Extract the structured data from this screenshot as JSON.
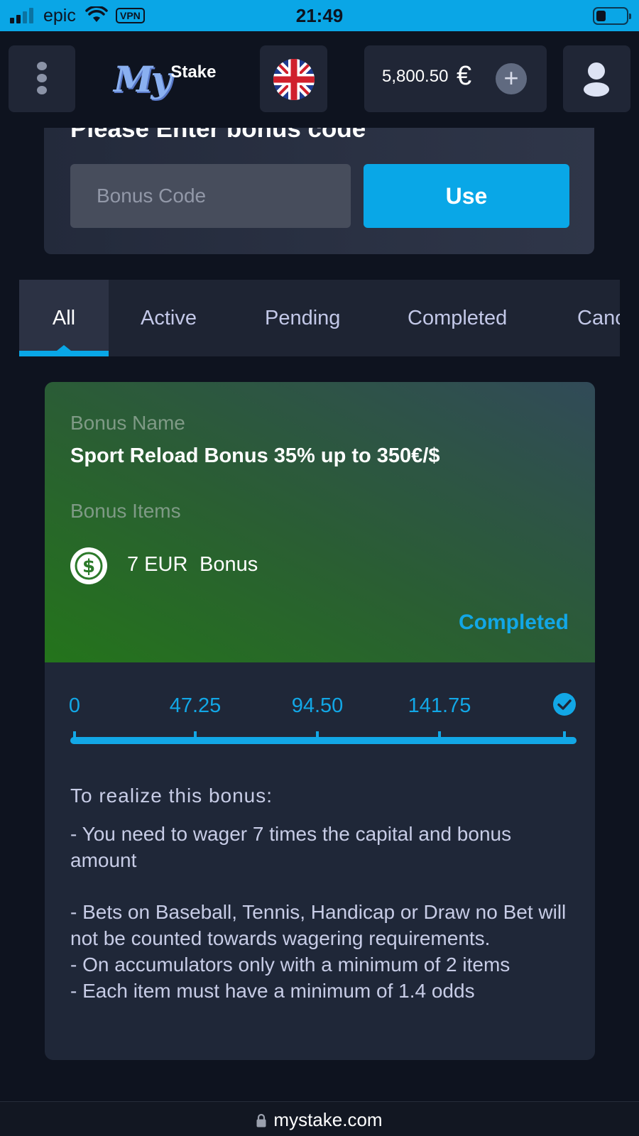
{
  "status_bar": {
    "carrier": "epic",
    "vpn": "VPN",
    "time": "21:49"
  },
  "header": {
    "logo_my": "My",
    "logo_stake": "Stake",
    "balance": "5,800.50",
    "currency_symbol": "€",
    "add_funds": "+"
  },
  "bonus_code": {
    "title": "Please Enter bonus code",
    "placeholder": "Bonus Code",
    "use_label": "Use"
  },
  "tabs": [
    "All",
    "Active",
    "Pending",
    "Completed",
    "Cancelled"
  ],
  "active_tab": "All",
  "bonus_card": {
    "name_label": "Bonus Name",
    "name": "Sport Reload Bonus 35% up to 350€/$",
    "items_label": "Bonus Items",
    "item_amount": "7 EUR",
    "item_type": "Bonus",
    "status": "Completed",
    "progress": {
      "ticks": [
        "0",
        "47.25",
        "94.50",
        "141.75"
      ],
      "fraction": 1.0
    },
    "description_heading": "To realize this bonus:",
    "description_lines": [
      "- You need to wager 7 times the capital and bonus amount",
      "- Bets on Baseball, Tennis, Handicap or Draw no Bet will not be counted towards wagering requirements.",
      "- On accumulators only with a minimum of 2 items",
      "- Each item must have a minimum of 1.4 odds"
    ]
  },
  "url_bar": {
    "url": "mystake.com"
  },
  "colors": {
    "accent": "#09a7e7",
    "status_bar": "#0aa6e6",
    "background": "#0e131f",
    "card": "#1f2738",
    "card_top_green": "#24741b"
  },
  "icons": [
    "signal-icon",
    "wifi-icon",
    "battery-icon",
    "menu-dots-icon",
    "uk-flag-icon",
    "plus-icon",
    "user-icon",
    "dollar-coin-icon",
    "check-circle-icon",
    "lock-icon"
  ]
}
